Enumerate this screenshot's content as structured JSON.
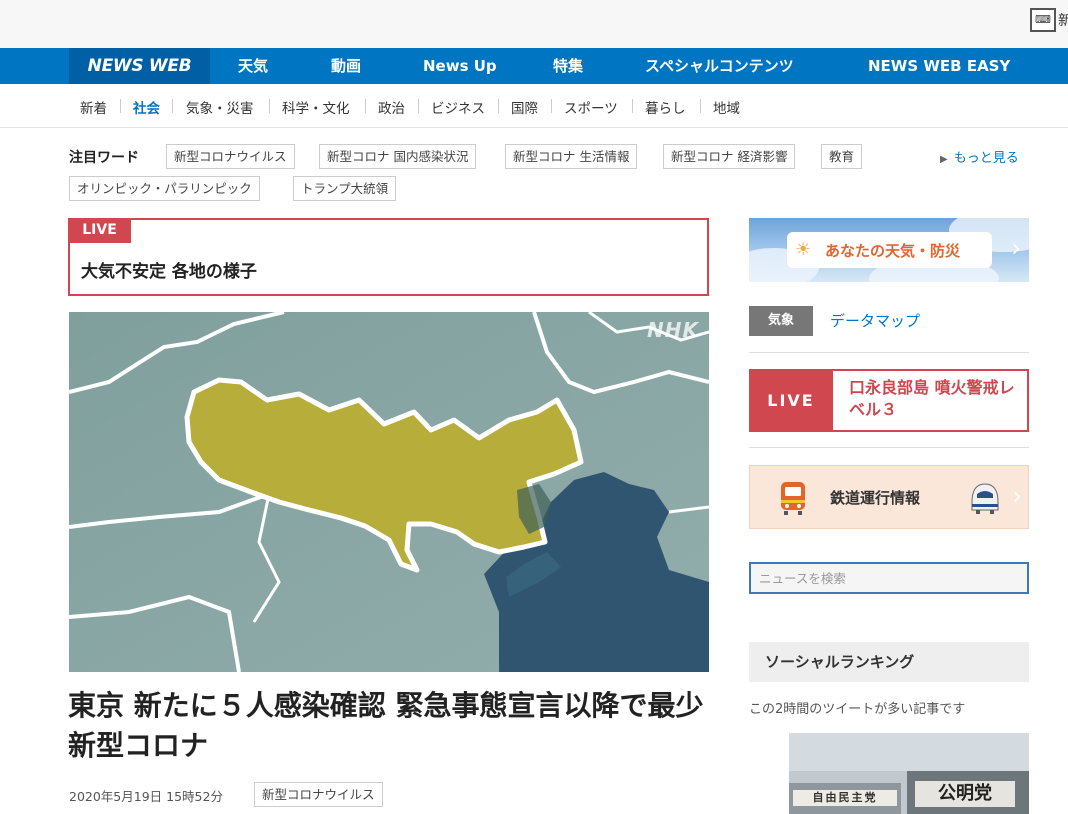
{
  "corner": {
    "icon_name": "keyboard-icon",
    "label": "新"
  },
  "nav": {
    "logo": "NEWS WEB",
    "items": [
      "天気",
      "動画",
      "News Up",
      "特集",
      "スペシャルコンテンツ",
      "NEWS WEB EASY"
    ]
  },
  "categories": [
    "新着",
    "社会",
    "気象・災害",
    "科学・文化",
    "政治",
    "ビジネス",
    "国際",
    "スポーツ",
    "暮らし",
    "地域"
  ],
  "active_category": "社会",
  "keywords": {
    "title": "注目ワード",
    "tags": [
      "新型コロナウイルス",
      "新型コロナ 国内感染状況",
      "新型コロナ 生活情報",
      "新型コロナ 経済影響",
      "教育",
      "オリンピック・パラリンピック",
      "トランプ大統領"
    ],
    "more": "もっと見る"
  },
  "live": {
    "label": "LIVE",
    "title": "大気不安定 各地の様子"
  },
  "article_image": {
    "watermark": "NHK"
  },
  "article": {
    "headline": "東京 新たに５人感染確認 緊急事態宣言以降で最少 新型コロナ",
    "date": "2020年5月19日 15時52分",
    "tag": "新型コロナウイルス"
  },
  "sidebar": {
    "weather": {
      "label": "あなたの天気・防災",
      "icon": "sun-cloud-icon"
    },
    "kisho": {
      "badge": "気象",
      "link": "データマップ"
    },
    "volcano": {
      "live": "LIVE",
      "text": "口永良部島 噴火警戒レベル３"
    },
    "train": {
      "label": "鉄道運行情報"
    },
    "search": {
      "placeholder": "ニュースを検索"
    },
    "social": {
      "title": "ソーシャルランキング",
      "subtitle": "この2時間のツイートが多い記事です"
    },
    "thumb": {
      "sign1": "自由民主党",
      "sign2": "公明党"
    }
  },
  "colors": {
    "nav_blue": "#0075c2",
    "logo_bg": "#005fa5",
    "live_red": "#d0474f",
    "tokyo_yellow": "#b7ad3a",
    "bay_blue": "#2f5570"
  }
}
